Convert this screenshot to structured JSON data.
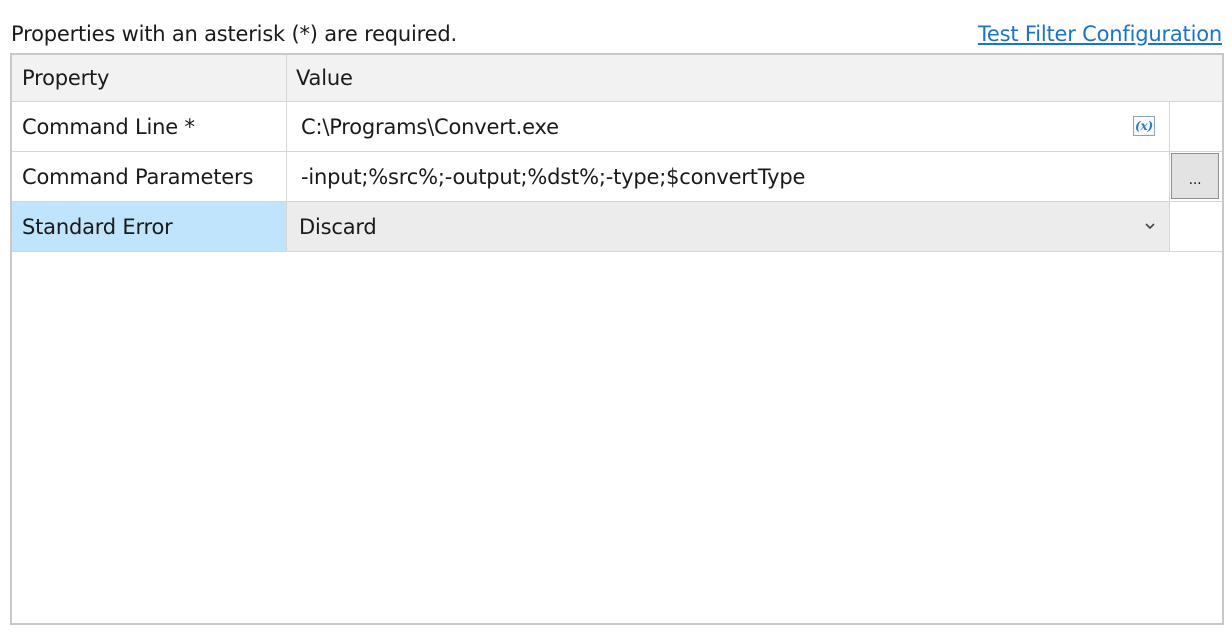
{
  "header": {
    "hint": "Properties with an asterisk (*) are required.",
    "test_link": "Test Filter Configuration"
  },
  "grid": {
    "columns": [
      "Property",
      "Value"
    ],
    "rows": [
      {
        "property": "Command Line *",
        "value": "C:\\Programs\\Convert.exe",
        "action_icon": "variable-icon"
      },
      {
        "property": "Command Parameters",
        "value": "-input;%src%;-output;%dst%;-type;$convertType",
        "action_label": "..."
      },
      {
        "property": "Standard Error",
        "value": "Discard",
        "control": "dropdown",
        "selected": true
      }
    ],
    "variable_icon_label": "(x)"
  },
  "colors": {
    "link": "#1a73cc",
    "selected_row": "#bfe4fb",
    "header_bg": "#f2f2f2"
  }
}
